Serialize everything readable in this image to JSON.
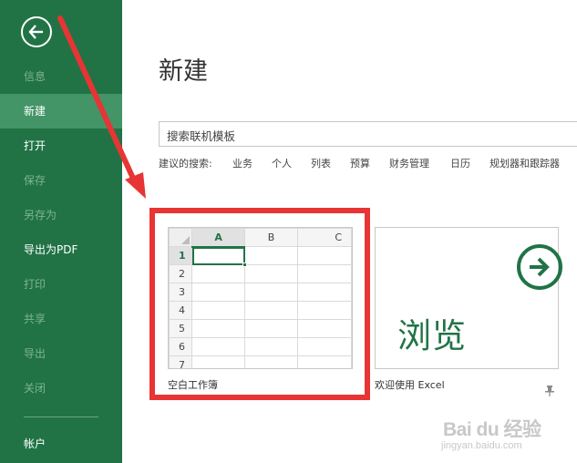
{
  "sidebar": {
    "items": [
      {
        "label": "信息",
        "state": "disabled"
      },
      {
        "label": "新建",
        "state": "active"
      },
      {
        "label": "打开",
        "state": "normal"
      },
      {
        "label": "保存",
        "state": "disabled"
      },
      {
        "label": "另存为",
        "state": "disabled"
      },
      {
        "label": "导出为PDF",
        "state": "normal"
      },
      {
        "label": "打印",
        "state": "disabled"
      },
      {
        "label": "共享",
        "state": "disabled"
      },
      {
        "label": "导出",
        "state": "disabled"
      },
      {
        "label": "关闭",
        "state": "disabled"
      }
    ],
    "account": "帐户"
  },
  "main": {
    "title": "新建",
    "search": {
      "value": "搜索联机模板",
      "placeholder": "搜索联机模板"
    },
    "suggested": {
      "label": "建议的搜索:",
      "links": [
        "业务",
        "个人",
        "列表",
        "预算",
        "财务管理",
        "日历",
        "规划器和跟踪器"
      ]
    },
    "templates": [
      {
        "name": "空白工作簿",
        "columns": [
          "A",
          "B",
          "C"
        ],
        "rows": [
          "1",
          "2",
          "3",
          "4",
          "5",
          "6",
          "7"
        ]
      },
      {
        "name": "欢迎使用 Excel",
        "thumbnail_text": "浏览"
      }
    ]
  },
  "watermark": {
    "main": "Bai du 经验",
    "sub": "jingyan.baidu.com"
  },
  "colors": {
    "sidebar": "#217346",
    "active": "#439467",
    "highlight": "#e83434"
  },
  "icons": [
    "back-arrow-icon",
    "arrow-right-circle-icon",
    "pin-icon"
  ]
}
